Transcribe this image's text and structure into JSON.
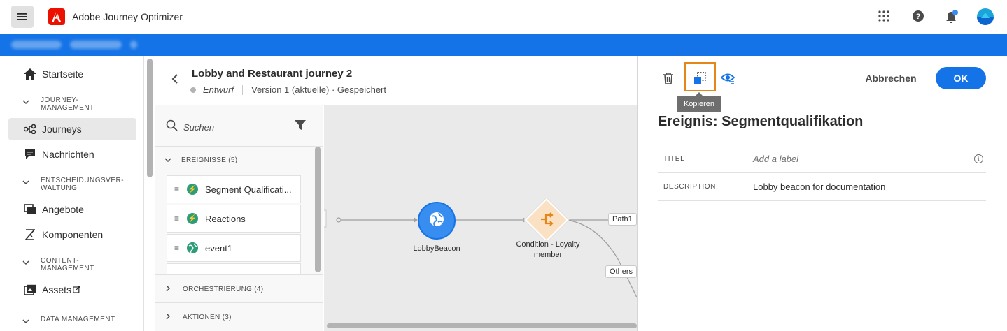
{
  "app": {
    "title": "Adobe Journey Optimizer"
  },
  "colors": {
    "accent": "#1473e6",
    "brand": "#eb1000",
    "highlight": "#e68619",
    "event_green": "#2d9d78",
    "condition_orange": "#e68619"
  },
  "topbar": {
    "icons": [
      "apps-grid-icon",
      "help-icon",
      "notifications-icon",
      "user-avatar"
    ]
  },
  "sidebar": {
    "items": [
      {
        "label": "Startseite",
        "icon": "home-icon"
      },
      {
        "group": [
          "JOURNEY-",
          "MANAGEMENT"
        ]
      },
      {
        "label": "Journeys",
        "icon": "journeys-icon",
        "active": true
      },
      {
        "label": "Nachrichten",
        "icon": "messages-icon"
      },
      {
        "group": [
          "ENTSCHEIDUNGSVER-",
          "WALTUNG"
        ]
      },
      {
        "label": "Angebote",
        "icon": "offers-icon"
      },
      {
        "label": "Komponenten",
        "icon": "components-icon"
      },
      {
        "group": [
          "CONTENT-",
          "MANAGEMENT"
        ]
      },
      {
        "label": "Assets",
        "icon": "assets-icon"
      },
      {
        "group": [
          "DATA MANAGEMENT"
        ]
      }
    ]
  },
  "journey": {
    "title": "Lobby and Restaurant journey 2",
    "status": "Entwurf",
    "version": "Version 1 (aktuelle) · Gespeichert"
  },
  "palette": {
    "search_placeholder": "Suchen",
    "events_header": "EREIGNISSE (5)",
    "events": [
      "Segment Qualificati...",
      "Reactions",
      "event1"
    ],
    "orchestration_header": "ORCHESTRIERUNG (4)",
    "actions_header": "AKTIONEN (3)"
  },
  "canvas": {
    "nodes": [
      {
        "label": "LobbyBeacon",
        "type": "event"
      },
      {
        "label_line1": "Condition - Loyalty",
        "label_line2": "member",
        "type": "condition"
      }
    ],
    "paths": [
      "Path1",
      "Others"
    ]
  },
  "panel": {
    "toolbar": {
      "delete": "trash-icon",
      "copy": "copy-icon",
      "preview": "eye-icon",
      "tooltip": "Kopieren"
    },
    "cancel_label": "Abbrechen",
    "ok_label": "OK",
    "title": "Ereignis: Segmentqualifikation",
    "fields": [
      {
        "key": "TITEL",
        "value": "Add a label",
        "placeholder": true
      },
      {
        "key": "DESCRIPTION",
        "value": "Lobby beacon for documentation"
      }
    ]
  }
}
